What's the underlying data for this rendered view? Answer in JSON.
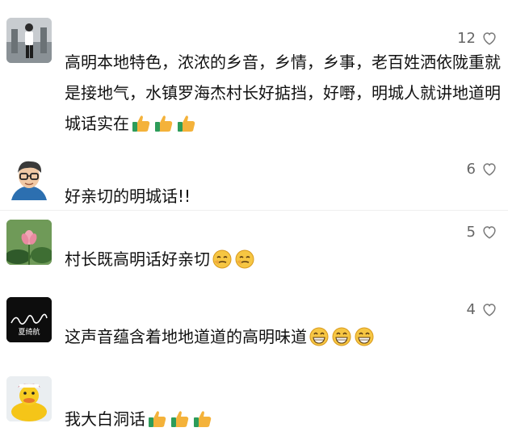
{
  "comments": [
    {
      "likes": "12",
      "text": "高明本地特色，浓浓的乡音，乡情，乡事，老百姓洒依陇重就是接地气，水镇罗海杰村长好掂挡，好嘢，明城人就讲地道明城话实在",
      "emojis": [
        "thumbs-up",
        "thumbs-up",
        "thumbs-up"
      ]
    },
    {
      "likes": "6",
      "text": "好亲切的明城话!!",
      "emojis": []
    },
    {
      "likes": "5",
      "text": "村长既高明话好亲切",
      "emojis": [
        "smirk",
        "smirk"
      ]
    },
    {
      "likes": "4",
      "text": "这声音蕴含着地地道道的高明味道",
      "emojis": [
        "grin",
        "grin",
        "grin"
      ]
    },
    {
      "likes": "",
      "text": "我大白洞话",
      "emojis": [
        "thumbs-up",
        "thumbs-up",
        "thumbs-up"
      ]
    }
  ],
  "avatars": {
    "a4_signature": "夏绮航"
  },
  "colors": {
    "text": "#111111",
    "meta": "#666666",
    "thumb": "#f4b23a",
    "cuff": "#2d9c5a"
  }
}
